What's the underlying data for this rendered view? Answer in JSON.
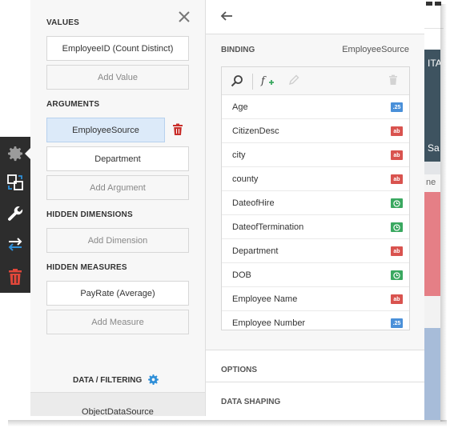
{
  "background": {
    "text_a": "ITA",
    "text_b": "Sa",
    "text_c": "ne"
  },
  "toolbar": {
    "items": [
      {
        "icon": "gear-icon",
        "active": true
      },
      {
        "icon": "convert-to-icon"
      },
      {
        "icon": "wrench-icon"
      },
      {
        "icon": "interactivity-arrows-icon"
      },
      {
        "icon": "delete-trash-icon"
      }
    ]
  },
  "data_items": {
    "values": {
      "title": "VALUES",
      "items": [
        "EmployeeID (Count Distinct)"
      ],
      "add_label": "Add Value"
    },
    "arguments": {
      "title": "ARGUMENTS",
      "items": [
        "EmployeeSource",
        "Department"
      ],
      "add_label": "Add Argument"
    },
    "hidden_dimensions": {
      "title": "HIDDEN DIMENSIONS",
      "add_label": "Add Dimension"
    },
    "hidden_measures": {
      "title": "HIDDEN MEASURES",
      "items": [
        "PayRate (Average)"
      ],
      "add_label": "Add Measure"
    },
    "data_filtering": {
      "title": "DATA / FILTERING",
      "datasource": "ObjectDataSource"
    }
  },
  "binding": {
    "title": "BINDING",
    "current": "EmployeeSource",
    "fields": [
      {
        "name": "Age",
        "type": "number",
        "badge": ".25"
      },
      {
        "name": "CitizenDesc",
        "type": "string",
        "badge": "ab"
      },
      {
        "name": "city",
        "type": "string",
        "badge": "ab"
      },
      {
        "name": "county",
        "type": "string",
        "badge": "ab"
      },
      {
        "name": "DateofHire",
        "type": "date",
        "badge": ""
      },
      {
        "name": "DateofTermination",
        "type": "date",
        "badge": ""
      },
      {
        "name": "Department",
        "type": "string",
        "badge": "ab"
      },
      {
        "name": "DOB",
        "type": "date",
        "badge": ""
      },
      {
        "name": "Employee Name",
        "type": "string",
        "badge": "ab"
      },
      {
        "name": "Employee Number",
        "type": "number",
        "badge": ".25"
      }
    ]
  },
  "sections": {
    "options": "OPTIONS",
    "data_shaping": "DATA SHAPING"
  },
  "colors": {
    "accent": "#2f8fd8",
    "number_badge": "#4a90d9",
    "string_badge": "#d9534f",
    "date_badge": "#3aa860",
    "toolbar_bg": "#2d2d2d",
    "delete_red": "#e2473a"
  }
}
